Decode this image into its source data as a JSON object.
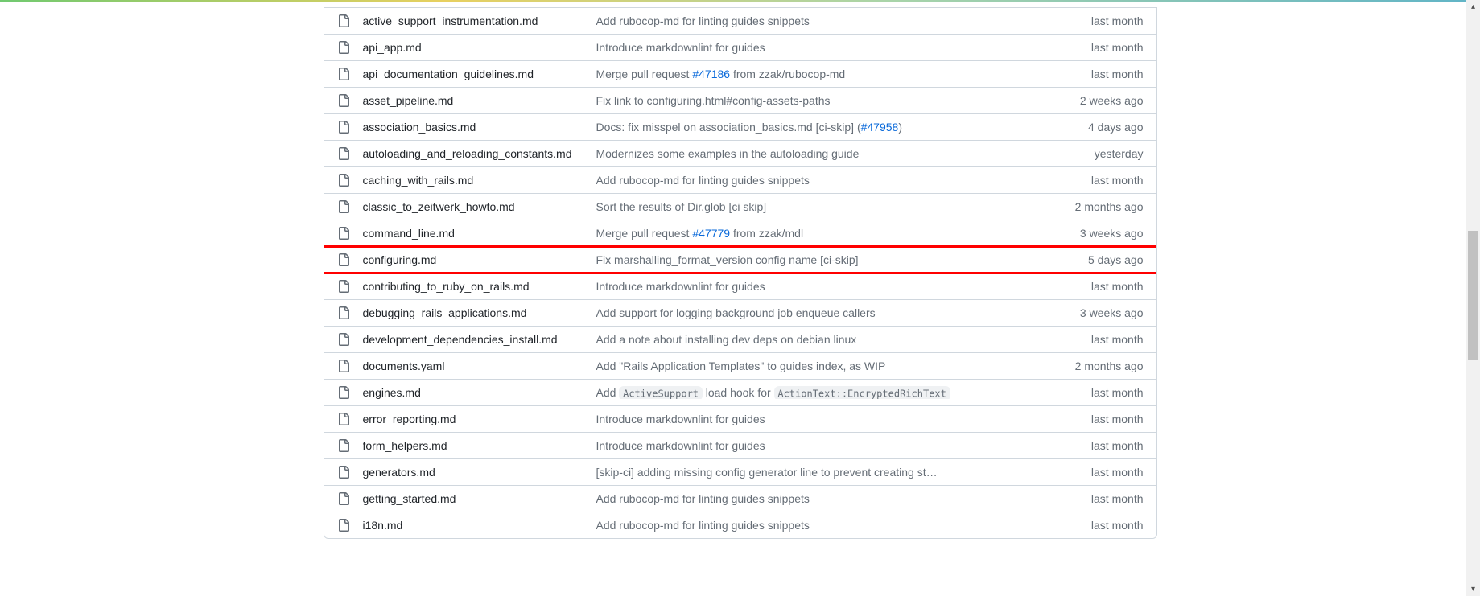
{
  "files": [
    {
      "name": "active_support_instrumentation.md",
      "message": [
        {
          "type": "text",
          "value": "Add rubocop-md for linting guides snippets"
        }
      ],
      "time": "last month",
      "highlighted": false
    },
    {
      "name": "api_app.md",
      "message": [
        {
          "type": "text",
          "value": "Introduce markdownlint for guides"
        }
      ],
      "time": "last month",
      "highlighted": false
    },
    {
      "name": "api_documentation_guidelines.md",
      "message": [
        {
          "type": "text",
          "value": "Merge pull request "
        },
        {
          "type": "issue",
          "value": "#47186"
        },
        {
          "type": "text",
          "value": " from zzak/rubocop-md"
        }
      ],
      "time": "last month",
      "highlighted": false
    },
    {
      "name": "asset_pipeline.md",
      "message": [
        {
          "type": "text",
          "value": "Fix link to configuring.html#config-assets-paths"
        }
      ],
      "time": "2 weeks ago",
      "highlighted": false
    },
    {
      "name": "association_basics.md",
      "message": [
        {
          "type": "text",
          "value": "Docs: fix misspel on association_basics.md [ci-skip] ("
        },
        {
          "type": "issue",
          "value": "#47958"
        },
        {
          "type": "text",
          "value": ")"
        }
      ],
      "time": "4 days ago",
      "highlighted": false
    },
    {
      "name": "autoloading_and_reloading_constants.md",
      "message": [
        {
          "type": "text",
          "value": "Modernizes some examples in the autoloading guide"
        }
      ],
      "time": "yesterday",
      "highlighted": false
    },
    {
      "name": "caching_with_rails.md",
      "message": [
        {
          "type": "text",
          "value": "Add rubocop-md for linting guides snippets"
        }
      ],
      "time": "last month",
      "highlighted": false
    },
    {
      "name": "classic_to_zeitwerk_howto.md",
      "message": [
        {
          "type": "text",
          "value": "Sort the results of Dir.glob [ci skip]"
        }
      ],
      "time": "2 months ago",
      "highlighted": false
    },
    {
      "name": "command_line.md",
      "message": [
        {
          "type": "text",
          "value": "Merge pull request "
        },
        {
          "type": "issue",
          "value": "#47779"
        },
        {
          "type": "text",
          "value": " from zzak/mdl"
        }
      ],
      "time": "3 weeks ago",
      "highlighted": false
    },
    {
      "name": "configuring.md",
      "message": [
        {
          "type": "text",
          "value": "Fix marshalling_format_version config name [ci-skip]"
        }
      ],
      "time": "5 days ago",
      "highlighted": true
    },
    {
      "name": "contributing_to_ruby_on_rails.md",
      "message": [
        {
          "type": "text",
          "value": "Introduce markdownlint for guides"
        }
      ],
      "time": "last month",
      "highlighted": false
    },
    {
      "name": "debugging_rails_applications.md",
      "message": [
        {
          "type": "text",
          "value": "Add support for logging background job enqueue callers"
        }
      ],
      "time": "3 weeks ago",
      "highlighted": false
    },
    {
      "name": "development_dependencies_install.md",
      "message": [
        {
          "type": "text",
          "value": "Add a note about installing dev deps on debian linux"
        }
      ],
      "time": "last month",
      "highlighted": false
    },
    {
      "name": "documents.yaml",
      "message": [
        {
          "type": "text",
          "value": "Add \"Rails Application Templates\" to guides index, as WIP"
        }
      ],
      "time": "2 months ago",
      "highlighted": false
    },
    {
      "name": "engines.md",
      "message": [
        {
          "type": "text",
          "value": "Add "
        },
        {
          "type": "code",
          "value": "ActiveSupport"
        },
        {
          "type": "text",
          "value": " load hook for "
        },
        {
          "type": "code",
          "value": "ActionText::EncryptedRichText"
        }
      ],
      "time": "last month",
      "highlighted": false
    },
    {
      "name": "error_reporting.md",
      "message": [
        {
          "type": "text",
          "value": "Introduce markdownlint for guides"
        }
      ],
      "time": "last month",
      "highlighted": false
    },
    {
      "name": "form_helpers.md",
      "message": [
        {
          "type": "text",
          "value": "Introduce markdownlint for guides"
        }
      ],
      "time": "last month",
      "highlighted": false
    },
    {
      "name": "generators.md",
      "message": [
        {
          "type": "text",
          "value": "[skip-ci] adding missing config generator line to prevent creating st…"
        }
      ],
      "time": "last month",
      "highlighted": false
    },
    {
      "name": "getting_started.md",
      "message": [
        {
          "type": "text",
          "value": "Add rubocop-md for linting guides snippets"
        }
      ],
      "time": "last month",
      "highlighted": false
    },
    {
      "name": "i18n.md",
      "message": [
        {
          "type": "text",
          "value": "Add rubocop-md for linting guides snippets"
        }
      ],
      "time": "last month",
      "highlighted": false
    }
  ]
}
